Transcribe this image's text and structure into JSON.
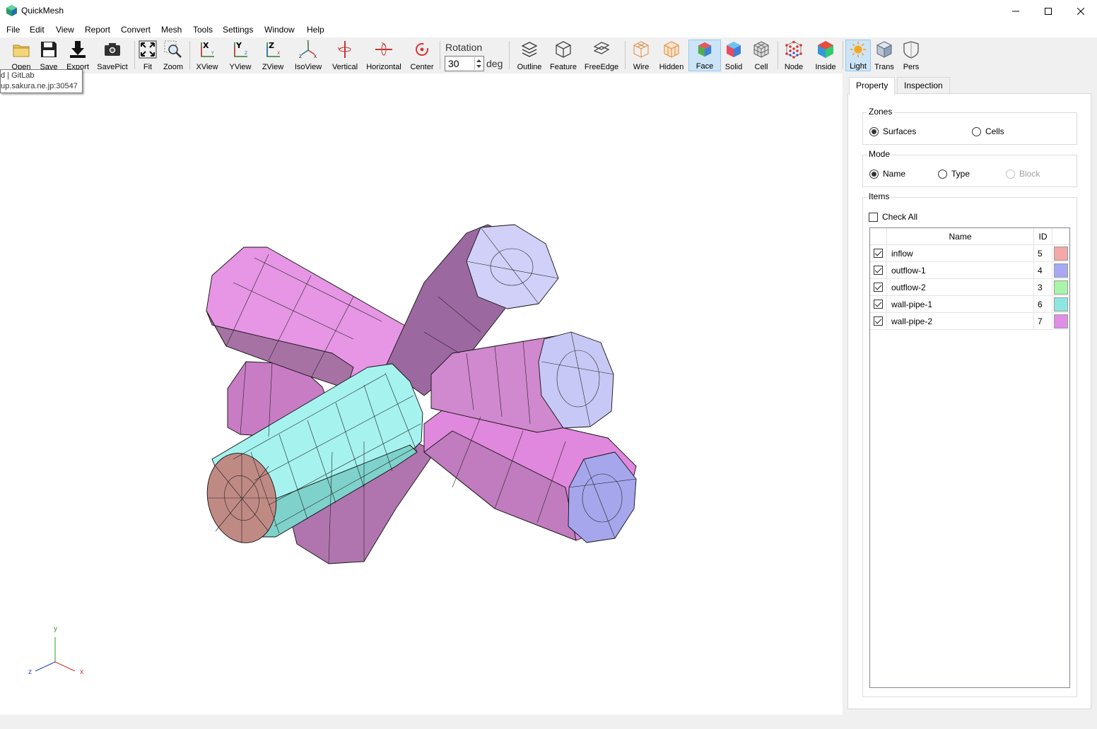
{
  "window": {
    "title": "QuickMesh",
    "controls": {
      "minimize": "—",
      "maximize": "☐",
      "close": "✕"
    }
  },
  "menu": [
    "File",
    "Edit",
    "View",
    "Report",
    "Convert",
    "Mesh",
    "Tools",
    "Settings",
    "Window",
    "Help"
  ],
  "toolbar": {
    "open": "Open",
    "save": "Save",
    "export": "Export",
    "savepict": "SavePict",
    "fit": "Fit",
    "zoom": "Zoom",
    "xview": "XView",
    "yview": "YView",
    "zview": "ZView",
    "isoview": "IsoView",
    "vertical": "Vertical",
    "horizontal": "Horizontal",
    "center": "Center",
    "rotation_label": "Rotation",
    "rotation_value": "30",
    "rotation_unit": "deg",
    "outline": "Outline",
    "feature": "Feature",
    "freeedge": "FreeEdge",
    "wire": "Wire",
    "hidden": "Hidden",
    "face": "Face",
    "solid": "Solid",
    "cell": "Cell",
    "node": "Node",
    "inside": "Inside",
    "light": "Light",
    "trans": "Trans",
    "pers": "Pers"
  },
  "tooltip": {
    "line1": "d | GitLab",
    "line2": "up.sakura.ne.jp:30547"
  },
  "axes": {
    "y": "y",
    "x": "x",
    "z": "z"
  },
  "panel": {
    "tabs": [
      "Property",
      "Inspection"
    ],
    "zones": {
      "title": "Zones",
      "surfaces": "Surfaces",
      "cells": "Cells"
    },
    "mode": {
      "title": "Mode",
      "name": "Name",
      "type": "Type",
      "block": "Block"
    },
    "items": {
      "title": "Items",
      "check_all": "Check All",
      "col_name": "Name",
      "col_id": "ID"
    },
    "rows": [
      {
        "name": "inflow",
        "id": "5",
        "color": "#f4a8a8"
      },
      {
        "name": "outflow-1",
        "id": "4",
        "color": "#a8a8f4"
      },
      {
        "name": "outflow-2",
        "id": "3",
        "color": "#a8f4a8"
      },
      {
        "name": "wall-pipe-1",
        "id": "6",
        "color": "#8ee6e0"
      },
      {
        "name": "wall-pipe-2",
        "id": "7",
        "color": "#e08ee6"
      }
    ]
  }
}
